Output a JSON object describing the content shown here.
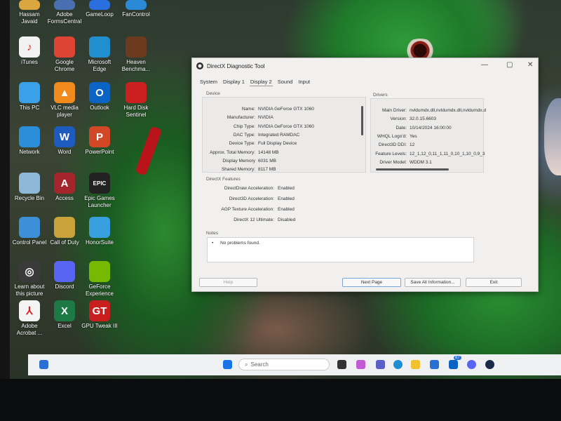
{
  "desktop_icons": [
    {
      "name": "hassam-javaid",
      "label": "Hassam Javaid",
      "color": "#d9a640",
      "glyph": ""
    },
    {
      "name": "adobe-formscentral",
      "label": "Adobe FormsCentral",
      "color": "#4a6fb0",
      "glyph": ""
    },
    {
      "name": "gameloop",
      "label": "GameLoop",
      "color": "#2a6fe0",
      "glyph": ""
    },
    {
      "name": "fancontrol",
      "label": "FanControl",
      "color": "#2b8ad8",
      "glyph": ""
    },
    {
      "name": "itunes",
      "label": "iTunes",
      "color": "#f2f2f2",
      "glyph": "♪"
    },
    {
      "name": "google-chrome",
      "label": "Google Chrome",
      "color": "#dd4433",
      "glyph": ""
    },
    {
      "name": "microsoft-edge",
      "label": "Microsoft Edge",
      "color": "#1f8fd0",
      "glyph": ""
    },
    {
      "name": "heaven-benchmark",
      "label": "Heaven Benchma...",
      "color": "#6b3a1f",
      "glyph": ""
    },
    {
      "name": "this-pc",
      "label": "This PC",
      "color": "#3aa0e8",
      "glyph": ""
    },
    {
      "name": "vlc",
      "label": "VLC media player",
      "color": "#f08a1c",
      "glyph": "▲"
    },
    {
      "name": "outlook",
      "label": "Outlook",
      "color": "#0b63c4",
      "glyph": "O"
    },
    {
      "name": "hard-disk-sentinel",
      "label": "Hard Disk Sentinel",
      "color": "#cc2020",
      "glyph": ""
    },
    {
      "name": "network",
      "label": "Network",
      "color": "#2a8fd8",
      "glyph": ""
    },
    {
      "name": "word",
      "label": "Word",
      "color": "#1d5bbf",
      "glyph": "W"
    },
    {
      "name": "powerpoint",
      "label": "PowerPoint",
      "color": "#d24726",
      "glyph": "P"
    },
    {
      "name": "recycle-bin",
      "label": "Recycle Bin",
      "color": "#8fb8d8",
      "glyph": ""
    },
    {
      "name": "access",
      "label": "Access",
      "color": "#a4262c",
      "glyph": "A"
    },
    {
      "name": "epic-games",
      "label": "Epic Games Launcher",
      "color": "#222222",
      "glyph": "EPIC"
    },
    {
      "name": "control-panel",
      "label": "Control Panel",
      "color": "#3d8fd8",
      "glyph": ""
    },
    {
      "name": "call-of-duty",
      "label": "Call of Duty",
      "color": "#c9a23a",
      "glyph": ""
    },
    {
      "name": "honorsuite",
      "label": "HonorSuite",
      "color": "#39a0e0",
      "glyph": ""
    },
    {
      "name": "learn-about-picture",
      "label": "Learn about this picture",
      "color": "#3a3a3a",
      "glyph": "◎"
    },
    {
      "name": "discord",
      "label": "Discord",
      "color": "#5865f2",
      "glyph": ""
    },
    {
      "name": "geforce-experience",
      "label": "GeForce Experience",
      "color": "#76b900",
      "glyph": ""
    },
    {
      "name": "adobe-acrobat",
      "label": "Adobe Acrobat ...",
      "color": "#f4f4f4",
      "glyph": "⅄"
    },
    {
      "name": "excel",
      "label": "Excel",
      "color": "#1d7a45",
      "glyph": "X"
    },
    {
      "name": "gpu-tweak",
      "label": "GPU Tweak III",
      "color": "#c81e1e",
      "glyph": "GT"
    }
  ],
  "dialog": {
    "title": "DirectX Diagnostic Tool",
    "tabs": [
      "System",
      "Display 1",
      "Display 2",
      "Sound",
      "Input"
    ],
    "active_tab": "Display 2",
    "device_label": "Device",
    "drivers_label": "Drivers",
    "features_label": "DirectX Features",
    "notes_label": "Notes",
    "device": [
      {
        "k": "Name:",
        "v": "NVIDIA GeForce GTX 1060"
      },
      {
        "k": "Manufacturer:",
        "v": "NVIDIA"
      },
      {
        "k": "Chip Type:",
        "v": "NVIDIA GeForce GTX 1060"
      },
      {
        "k": "DAC Type:",
        "v": "Integrated RAMDAC"
      },
      {
        "k": "Device Type:",
        "v": "Full Display Device"
      },
      {
        "k": "Approx. Total Memory:",
        "v": "14148 MB"
      },
      {
        "k": "Display Memory",
        "v": "6031 MB"
      },
      {
        "k": "Shared Memory:",
        "v": "8117 MB"
      }
    ],
    "drivers": [
      {
        "k": "Main Driver:",
        "v": "nvldumdx.dll,nvldumdx.dll,nvldumdx.d"
      },
      {
        "k": "Version:",
        "v": "32.0.15.6603"
      },
      {
        "k": "Date:",
        "v": "10/14/2024 16:00:00"
      },
      {
        "k": "WHQL Logo'd:",
        "v": "Yes"
      },
      {
        "k": "Direct3D DDI:",
        "v": "12"
      },
      {
        "k": "Feature Levels:",
        "v": "12_1,12_0,11_1,11_0,10_1,10_0,9_3"
      },
      {
        "k": "Driver Model:",
        "v": "WDDM 3.1"
      }
    ],
    "features": [
      {
        "k": "DirectDraw Acceleration:",
        "v": "Enabled"
      },
      {
        "k": "Direct3D Acceleration:",
        "v": "Enabled"
      },
      {
        "k": "AGP Texture Acceleration:",
        "v": "Enabled"
      },
      {
        "k": "DirectX 12 Ultimate:",
        "v": "Disabled"
      }
    ],
    "notes": [
      "No problems found."
    ],
    "buttons": {
      "help": "Help",
      "next": "Next Page",
      "save": "Save All Information...",
      "exit": "Exit"
    }
  },
  "taskbar": {
    "search_placeholder": "Search",
    "badge": "87"
  }
}
